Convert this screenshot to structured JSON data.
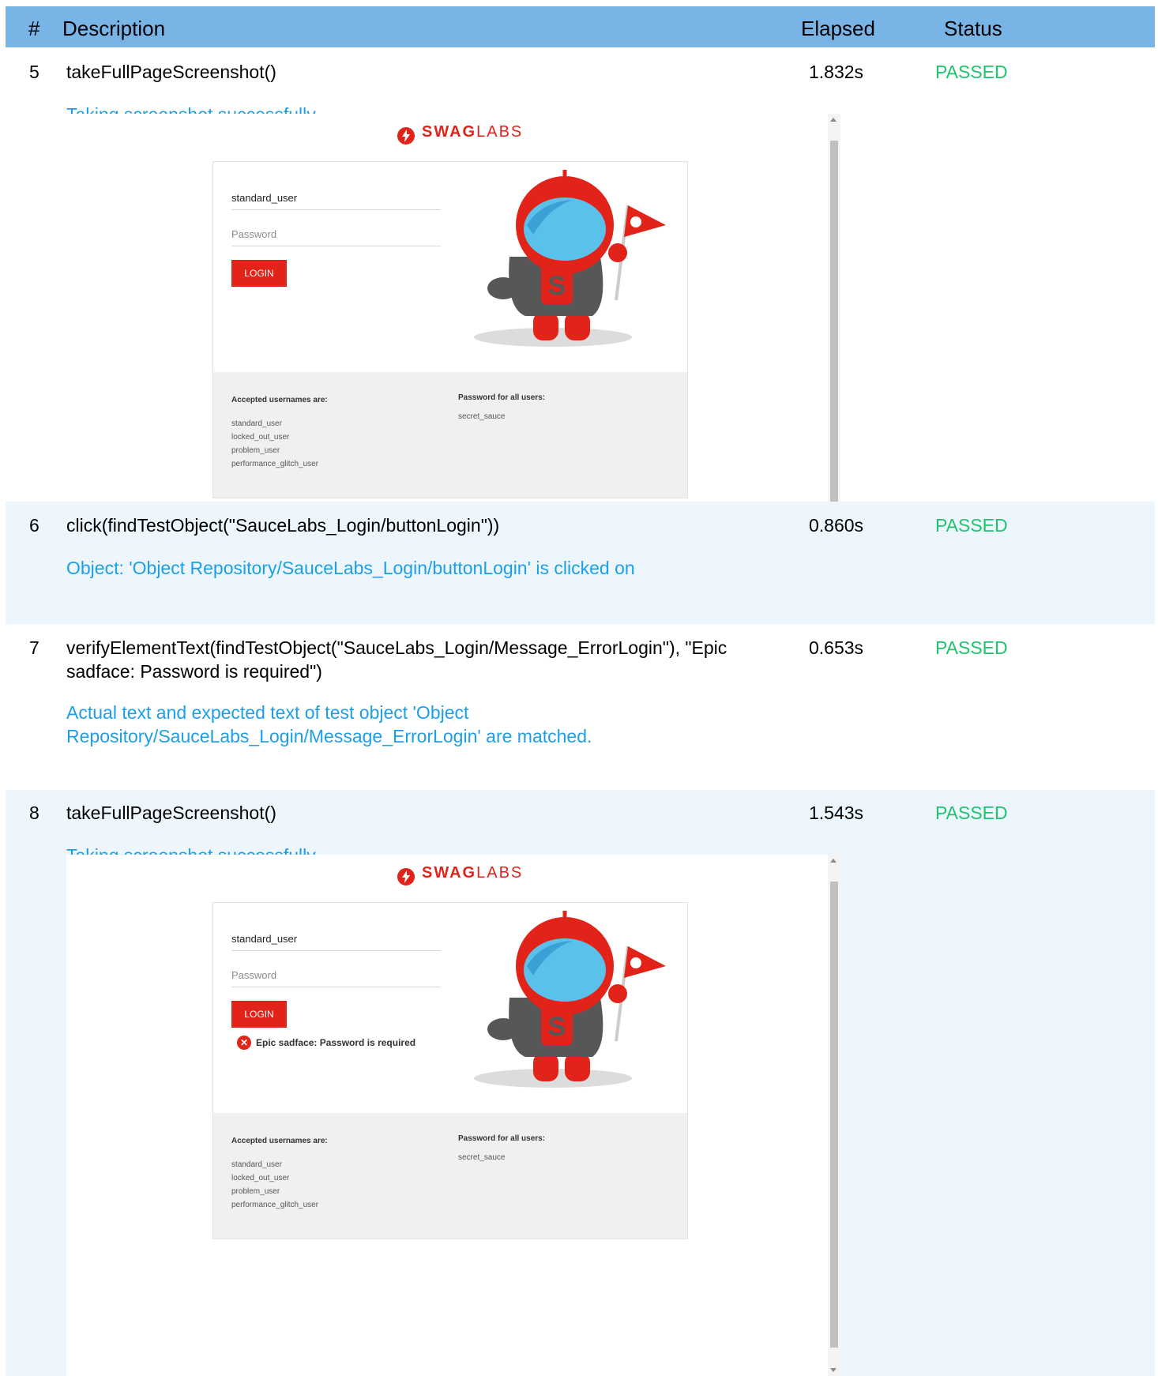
{
  "header": {
    "col_num": "#",
    "col_desc": "Description",
    "col_elapsed": "Elapsed",
    "col_status": "Status"
  },
  "steps": [
    {
      "num": "5",
      "desc": "takeFullPageScreenshot()",
      "elapsed": "1.832s",
      "status": "PASSED",
      "message": "Taking screenshot successfully"
    },
    {
      "num": "6",
      "desc": "click(findTestObject(\"SauceLabs_Login/buttonLogin\"))",
      "elapsed": "0.860s",
      "status": "PASSED",
      "message": "Object: 'Object Repository/SauceLabs_Login/buttonLogin' is clicked on"
    },
    {
      "num": "7",
      "desc": "verifyElementText(findTestObject(\"SauceLabs_Login/Message_ErrorLogin\"), \"Epic sadface: Password is required\")",
      "elapsed": "0.653s",
      "status": "PASSED",
      "message": "Actual text and expected text of test object 'Object Repository/SauceLabs_Login/Message_ErrorLogin' are matched."
    },
    {
      "num": "8",
      "desc": "takeFullPageScreenshot()",
      "elapsed": "1.543s",
      "status": "PASSED",
      "message": "Taking screenshot successfully"
    }
  ],
  "login_page": {
    "logo_bold": "SWAG",
    "logo_light": "LABS",
    "username_value": "standard_user",
    "password_placeholder": "Password",
    "login_label": "LOGIN",
    "error_text": "Epic sadface: Password is required",
    "accepted_heading": "Accepted usernames are:",
    "usernames": [
      "standard_user",
      "locked_out_user",
      "problem_user",
      "performance_glitch_user"
    ],
    "password_heading": "Password for all users:",
    "password_value": "secret_sauce"
  },
  "colors": {
    "header": "#78b4e6",
    "passed": "#1fc36e",
    "message": "#1d9fe6",
    "brand": "#e2231a"
  }
}
